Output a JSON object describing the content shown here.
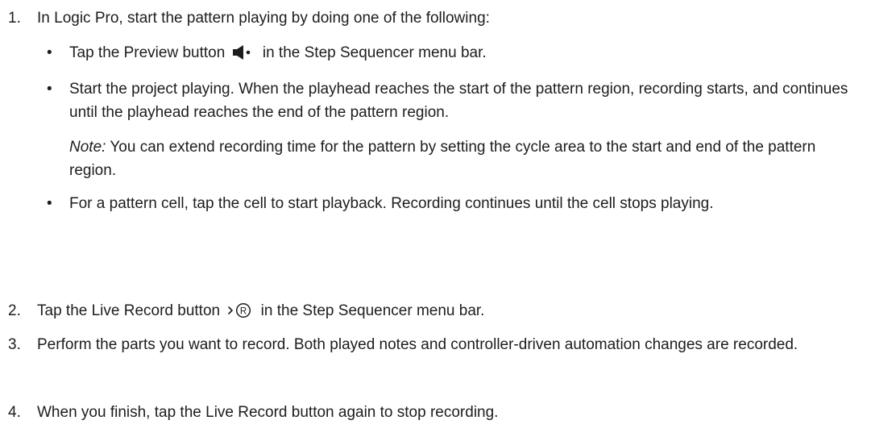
{
  "steps": [
    {
      "number": "1.",
      "text": "In Logic Pro, start the pattern playing by doing one of the following:",
      "bullets": [
        {
          "before": "Tap the Preview button",
          "icon": "speaker-preview-icon",
          "after": "in the Step Sequencer menu bar."
        },
        {
          "text": "Start the project playing. When the playhead reaches the start of the pattern region, recording starts, and continues until the playhead reaches the end of the pattern region.",
          "note_label": "Note:",
          "note_text": "You can extend recording time for the pattern by setting the cycle area to the start and end of the pattern region."
        },
        {
          "text": "For a pattern cell, tap the cell to start playback. Recording continues until the cell stops playing."
        }
      ]
    },
    {
      "number": "2.",
      "before": "Tap the Live Record button",
      "icon": "live-record-icon",
      "after": "in the Step Sequencer menu bar."
    },
    {
      "number": "3.",
      "text": "Perform the parts you want to record. Both played notes and controller-driven automation changes are recorded."
    },
    {
      "number": "4.",
      "text": "When you finish, tap the Live Record button again to stop recording."
    }
  ],
  "bullet_char": "•",
  "colors": {
    "text": "#1d1d1f",
    "background": "#ffffff"
  }
}
